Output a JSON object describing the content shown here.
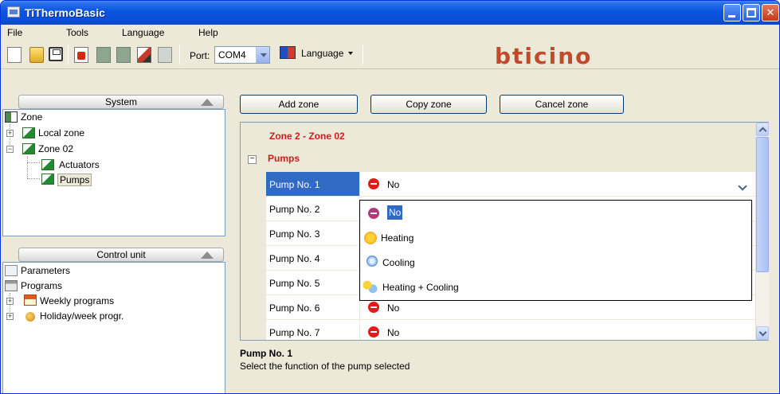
{
  "window": {
    "title": "TiThermoBasic"
  },
  "menu": {
    "file": "File",
    "tools": "Tools",
    "language": "Language",
    "help": "Help"
  },
  "toolbar": {
    "port_label": "Port:",
    "port_value": "COM4",
    "language_label": "Language",
    "brand": "bticino",
    "brand_color": "#c04a2a"
  },
  "system_panel": {
    "header": "System",
    "tree": {
      "root": "Zone",
      "local_zone": "Local zone",
      "zone_02": "Zone 02",
      "actuators": "Actuators",
      "pumps": "Pumps"
    }
  },
  "control_panel": {
    "header": "Control unit",
    "tree": {
      "parameters": "Parameters",
      "programs": "Programs",
      "weekly": "Weekly programs",
      "holiday": "Holiday/week progr."
    }
  },
  "actions": {
    "add": "Add zone",
    "copy": "Copy zone",
    "cancel": "Cancel zone"
  },
  "grid": {
    "zone_title": "Zone 2 - Zone 02",
    "category": "Pumps",
    "accent_color": "#d21a1a",
    "rows": [
      {
        "name": "Pump No. 1",
        "value": "No"
      },
      {
        "name": "Pump No. 2",
        "value": ""
      },
      {
        "name": "Pump No. 3",
        "value": ""
      },
      {
        "name": "Pump No. 4",
        "value": ""
      },
      {
        "name": "Pump No. 5",
        "value": ""
      },
      {
        "name": "Pump No. 6",
        "value": "No"
      },
      {
        "name": "Pump No. 7",
        "value": "No"
      }
    ]
  },
  "dropdown": {
    "options": [
      "No",
      "Heating",
      "Cooling",
      "Heating + Cooling"
    ],
    "selected": "No"
  },
  "description": {
    "title": "Pump No. 1",
    "text": "Select the function of the pump selected"
  }
}
